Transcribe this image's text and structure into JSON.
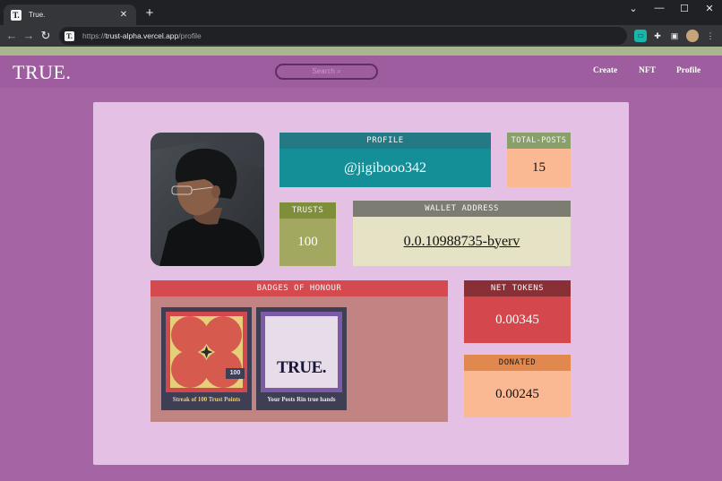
{
  "browser": {
    "tab_title": "True.",
    "favicon_letter": "T.",
    "url_scheme": "https://",
    "url_host": "trust-alpha.vercel.app",
    "url_path": "/profile"
  },
  "site": {
    "logo": "TRUE.",
    "search_placeholder": "Search ⌕",
    "nav": [
      "Create",
      "NFT",
      "Profile"
    ]
  },
  "profile": {
    "header": "PROFILE",
    "handle": "@jigibooo342"
  },
  "total_posts": {
    "header": "TOTAL-POSTS",
    "value": "15"
  },
  "trusts": {
    "header": "TRUSTS",
    "value": "100"
  },
  "wallet": {
    "header": "WALLET ADDRESS",
    "address": "0.0.10988735-byerv"
  },
  "badges": {
    "header": "BADGES OF HONOUR",
    "items": [
      {
        "caption": "Streak of 100 Trust Points",
        "tag": "100"
      },
      {
        "caption": "Your Posts Rin true hands",
        "logo": "TRUE."
      }
    ]
  },
  "net_tokens": {
    "header": "NET TOKENS",
    "value": "0.00345"
  },
  "donated": {
    "header": "DONATED",
    "value": "0.00245"
  },
  "colors": {
    "page_bg": "#a565a5",
    "card_bg": "#e5c0e5",
    "profile_teal": "#148f98",
    "badges_red": "#d44a4f",
    "net_tokens_red": "#d4474d",
    "peach": "#fbb993"
  }
}
